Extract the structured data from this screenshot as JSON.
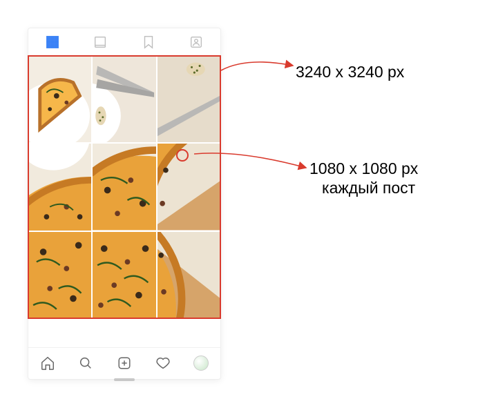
{
  "annotations": {
    "full_grid": "3240 x 3240 px",
    "single_post": "1080 x 1080 px",
    "single_post_sub": "каждый пост"
  },
  "profile_tabs": [
    "grid",
    "feed",
    "saved",
    "tagged"
  ],
  "bottom_nav": [
    "home",
    "search",
    "add",
    "activity",
    "profile"
  ],
  "icons": {
    "grid": "grid-icon",
    "feed": "feed-icon",
    "saved": "bookmark-icon",
    "tagged": "person-tag-icon",
    "home": "home-icon",
    "search": "search-icon",
    "add": "add-post-icon",
    "activity": "heart-icon",
    "profile": "avatar-icon"
  },
  "grid": {
    "rows": 3,
    "cols": 3,
    "subject": "pizza-photo"
  }
}
